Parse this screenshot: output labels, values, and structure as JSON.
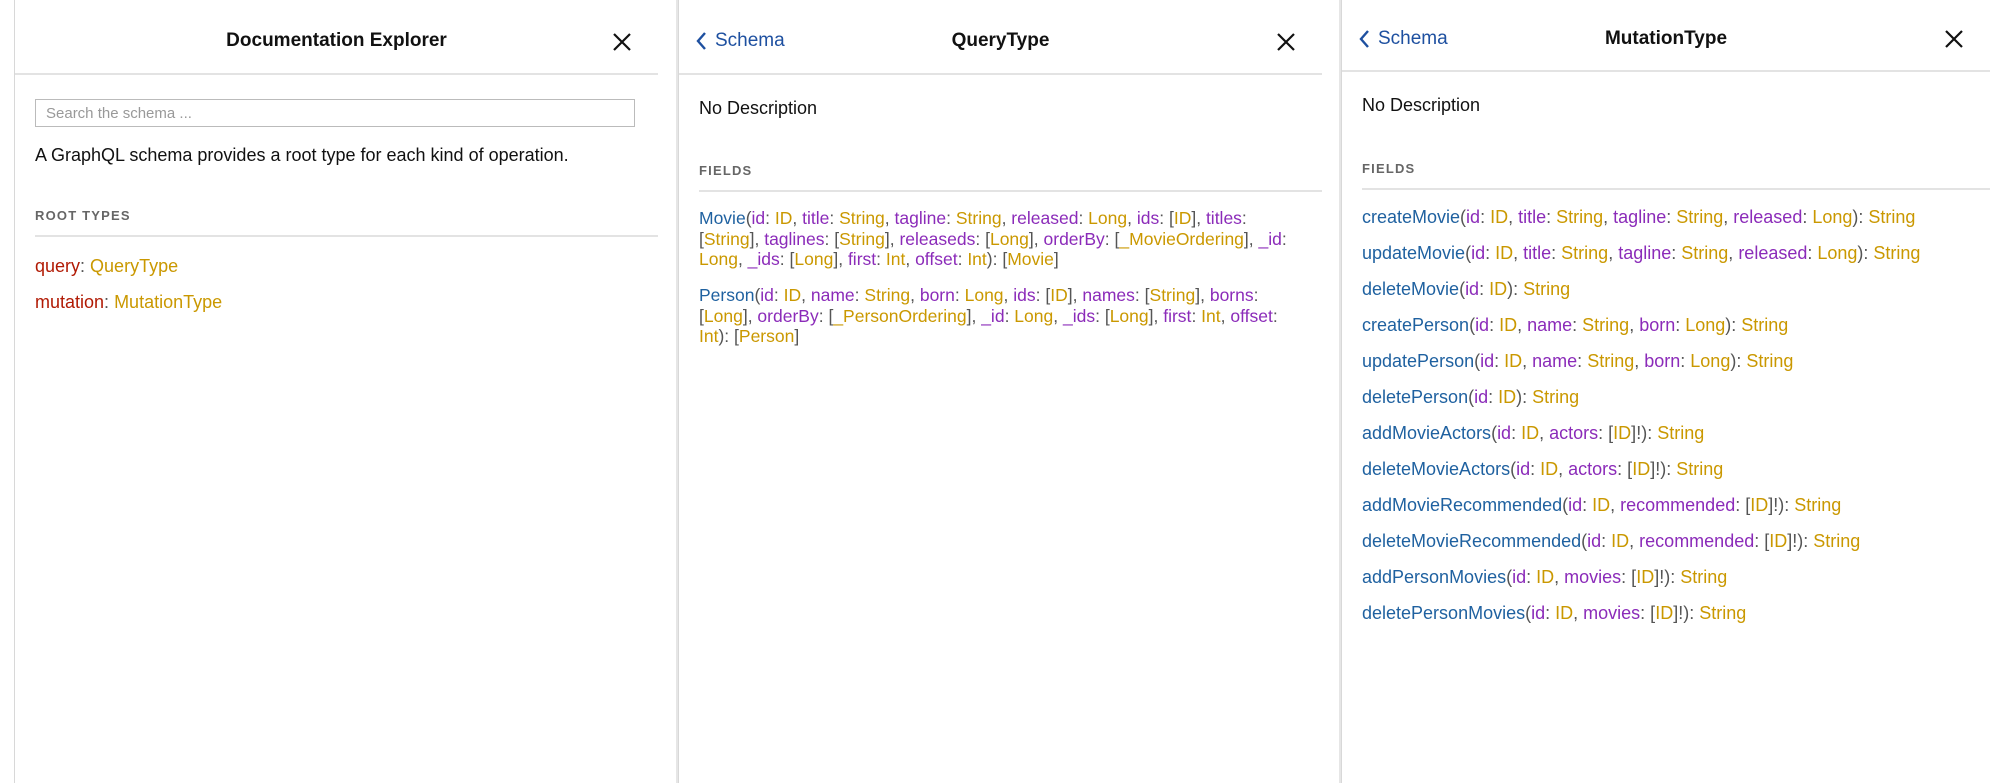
{
  "left_panel": {
    "title": "Documentation Explorer",
    "search_placeholder": "Search the schema ...",
    "description": "A GraphQL schema provides a root type for each kind of operation.",
    "section_label": "ROOT TYPES",
    "root_types": [
      {
        "key": "query",
        "type": "QueryType"
      },
      {
        "key": "mutation",
        "type": "MutationType"
      }
    ]
  },
  "middle_panel": {
    "back_label": "Schema",
    "title": "QueryType",
    "description": "No Description",
    "section_label": "FIELDS",
    "fields": [
      {
        "name": "Movie",
        "args": [
          {
            "name": "id",
            "type": "ID"
          },
          {
            "name": "title",
            "type": "String"
          },
          {
            "name": "tagline",
            "type": "String"
          },
          {
            "name": "released",
            "type": "Long"
          },
          {
            "name": "ids",
            "type": "ID",
            "list": true
          },
          {
            "name": "titles",
            "type": "String",
            "list": true
          },
          {
            "name": "taglines",
            "type": "String",
            "list": true
          },
          {
            "name": "releaseds",
            "type": "Long",
            "list": true
          },
          {
            "name": "orderBy",
            "type": "_MovieOrdering",
            "list": true
          },
          {
            "name": "_id",
            "type": "Long"
          },
          {
            "name": "_ids",
            "type": "Long",
            "list": true
          },
          {
            "name": "first",
            "type": "Int"
          },
          {
            "name": "offset",
            "type": "Int"
          }
        ],
        "return_type": "Movie",
        "return_list": true
      },
      {
        "name": "Person",
        "args": [
          {
            "name": "id",
            "type": "ID"
          },
          {
            "name": "name",
            "type": "String"
          },
          {
            "name": "born",
            "type": "Long"
          },
          {
            "name": "ids",
            "type": "ID",
            "list": true
          },
          {
            "name": "names",
            "type": "String",
            "list": true
          },
          {
            "name": "borns",
            "type": "Long",
            "list": true
          },
          {
            "name": "orderBy",
            "type": "_PersonOrdering",
            "list": true
          },
          {
            "name": "_id",
            "type": "Long"
          },
          {
            "name": "_ids",
            "type": "Long",
            "list": true
          },
          {
            "name": "first",
            "type": "Int"
          },
          {
            "name": "offset",
            "type": "Int"
          }
        ],
        "return_type": "Person",
        "return_list": true
      }
    ]
  },
  "right_panel": {
    "back_label": "Schema",
    "title": "MutationType",
    "description": "No Description",
    "section_label": "FIELDS",
    "mutations": [
      {
        "name": "createMovie",
        "args": [
          {
            "name": "id",
            "type": "ID"
          },
          {
            "name": "title",
            "type": "String"
          },
          {
            "name": "tagline",
            "type": "String"
          },
          {
            "name": "released",
            "type": "Long"
          }
        ],
        "return_type": "String"
      },
      {
        "name": "updateMovie",
        "args": [
          {
            "name": "id",
            "type": "ID"
          },
          {
            "name": "title",
            "type": "String"
          },
          {
            "name": "tagline",
            "type": "String"
          },
          {
            "name": "released",
            "type": "Long"
          }
        ],
        "return_type": "String"
      },
      {
        "name": "deleteMovie",
        "args": [
          {
            "name": "id",
            "type": "ID"
          }
        ],
        "return_type": "String"
      },
      {
        "name": "createPerson",
        "args": [
          {
            "name": "id",
            "type": "ID"
          },
          {
            "name": "name",
            "type": "String"
          },
          {
            "name": "born",
            "type": "Long"
          }
        ],
        "return_type": "String"
      },
      {
        "name": "updatePerson",
        "args": [
          {
            "name": "id",
            "type": "ID"
          },
          {
            "name": "name",
            "type": "String"
          },
          {
            "name": "born",
            "type": "Long"
          }
        ],
        "return_type": "String"
      },
      {
        "name": "deletePerson",
        "args": [
          {
            "name": "id",
            "type": "ID"
          }
        ],
        "return_type": "String"
      },
      {
        "name": "addMovieActors",
        "args": [
          {
            "name": "id",
            "type": "ID"
          },
          {
            "name": "actors",
            "type": "ID",
            "list": true,
            "nonnull": true
          }
        ],
        "return_type": "String"
      },
      {
        "name": "deleteMovieActors",
        "args": [
          {
            "name": "id",
            "type": "ID"
          },
          {
            "name": "actors",
            "type": "ID",
            "list": true,
            "nonnull": true
          }
        ],
        "return_type": "String"
      },
      {
        "name": "addMovieRecommended",
        "args": [
          {
            "name": "id",
            "type": "ID"
          },
          {
            "name": "recommended",
            "type": "ID",
            "list": true,
            "nonnull": true
          }
        ],
        "return_type": "String"
      },
      {
        "name": "deleteMovieRecommended",
        "args": [
          {
            "name": "id",
            "type": "ID"
          },
          {
            "name": "recommended",
            "type": "ID",
            "list": true,
            "nonnull": true
          }
        ],
        "return_type": "String"
      },
      {
        "name": "addPersonMovies",
        "args": [
          {
            "name": "id",
            "type": "ID"
          },
          {
            "name": "movies",
            "type": "ID",
            "list": true,
            "nonnull": true
          }
        ],
        "return_type": "String"
      },
      {
        "name": "deletePersonMovies",
        "args": [
          {
            "name": "id",
            "type": "ID"
          },
          {
            "name": "movies",
            "type": "ID",
            "list": true,
            "nonnull": true
          }
        ],
        "return_type": "String"
      }
    ]
  },
  "colors": {
    "keyword": "#b11a04",
    "type": "#ca9800",
    "field": "#1f61a0",
    "arg": "#8b2bb9",
    "link": "#1e50a0"
  },
  "icons": {
    "close": "close-icon",
    "back": "chevron-left-icon"
  }
}
